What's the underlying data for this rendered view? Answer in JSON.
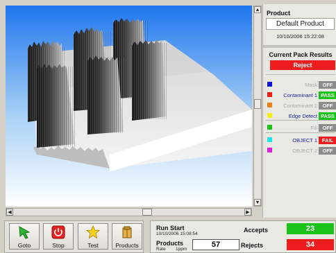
{
  "product": {
    "header": "Product",
    "name": "Default Product",
    "datetime": "10/10/2006 15:22:08"
  },
  "results": {
    "header": "Current Pack Results",
    "overall": "Reject",
    "rows": [
      {
        "label": "Mask",
        "state": "OFF",
        "swatch": "#1010dd",
        "state_color": "#8c8c8c",
        "label_color": "#a8a8a8"
      },
      {
        "label": "Contaminant 1",
        "state": "PASS",
        "swatch": "#ee1c1c",
        "state_color": "#19c319",
        "label_color": "#1c1ca8"
      },
      {
        "label": "Contaminant 2",
        "state": "OFF",
        "swatch": "#f07c12",
        "state_color": "#8c8c8c",
        "label_color": "#a8a8a8"
      },
      {
        "label": "Edge Detect",
        "state": "PASS",
        "swatch": "#f4ee1a",
        "state_color": "#19c319",
        "label_color": "#1c1ca8"
      },
      {
        "label": "Fill",
        "state": "OFF",
        "swatch": "#19c319",
        "state_color": "#8c8c8c",
        "label_color": "#a8a8a8"
      },
      {
        "label": "OBJECT 1",
        "state": "FAIL",
        "swatch": "#1de4e8",
        "state_color": "#ee1c1c",
        "label_color": "#1c1ca8"
      },
      {
        "label": "OBJECT 2",
        "state": "OFF",
        "swatch": "#e41ce4",
        "state_color": "#8c8c8c",
        "label_color": "#a8a8a8"
      }
    ]
  },
  "toolbar": {
    "goto": "Goto",
    "stop": "Stop",
    "test": "Test",
    "products": "Products"
  },
  "run": {
    "start_label": "Run Start",
    "start_time": "10/10/2006 15:08:54",
    "products_label": "Products",
    "rate_label": "Rate",
    "rate_value": "1ppm",
    "products_count": "57",
    "accepts_label": "Accepts",
    "accepts_value": "23",
    "rejects_label": "Rejects",
    "rejects_value": "34"
  },
  "colors": {
    "accept": "#19c319",
    "reject": "#ee1c1c"
  }
}
